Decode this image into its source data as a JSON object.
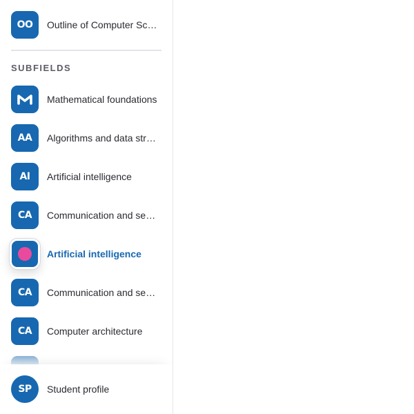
{
  "top_item": {
    "icon_text": "OO",
    "label": "Outline of Computer Science"
  },
  "section": {
    "heading": "SUBFIELDS"
  },
  "subfields": [
    {
      "icon_text": "M",
      "label": "Mathematical foundations"
    },
    {
      "icon_text": "AA",
      "label": "Algorithms and data structures"
    },
    {
      "icon_text": "AI",
      "label": "Artificial intelligence"
    },
    {
      "icon_text": "CA",
      "label": "Communication and security"
    },
    {
      "icon_text": "",
      "label": "Artificial intelligence",
      "active": true,
      "dot_color": "#e94a9e"
    },
    {
      "icon_text": "CA",
      "label": "Communication and security"
    },
    {
      "icon_text": "CA",
      "label": "Computer architecture"
    }
  ],
  "footer": {
    "icon_text": "SP",
    "label": "Student profile"
  },
  "colors": {
    "accent": "#1768b0",
    "active_dot": "#e94a9e",
    "text": "#2a2a32",
    "heading": "#5b5b66"
  },
  "icons": {
    "top_item": "course-icon",
    "subfield": "subfield-icon",
    "active": "dragging-dot-icon",
    "footer": "profile-avatar-icon"
  }
}
